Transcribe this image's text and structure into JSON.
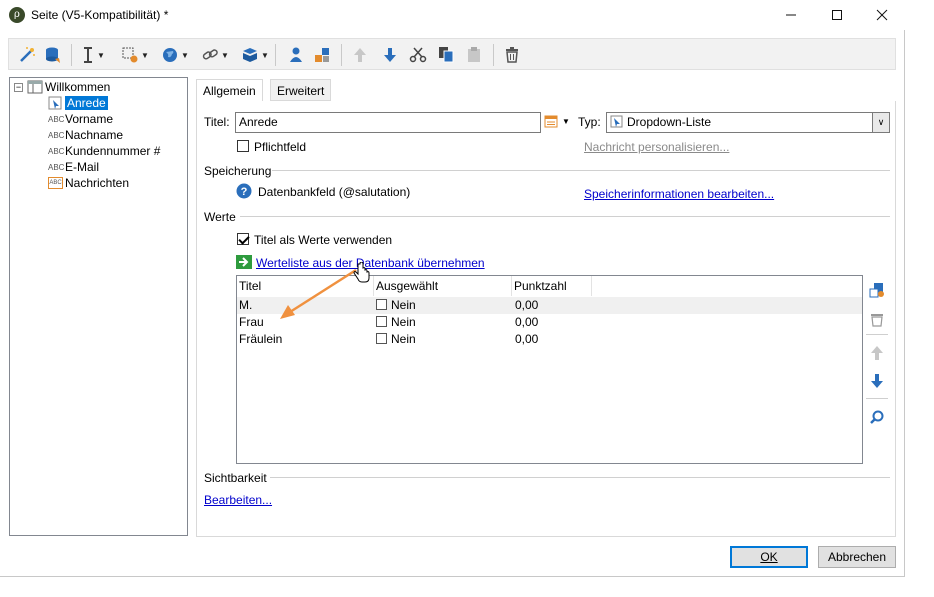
{
  "window": {
    "title": "Seite (V5-Kompatibilität) *"
  },
  "tree": {
    "root": "Willkommen",
    "items": [
      {
        "label": "Anrede",
        "selected": true
      },
      {
        "label": "Vorname",
        "type": "ABC"
      },
      {
        "label": "Nachname",
        "type": "ABC"
      },
      {
        "label": "Kundennummer #",
        "type": "ABC"
      },
      {
        "label": "E-Mail",
        "type": "ABC"
      },
      {
        "label": "Nachrichten",
        "type": "ABC"
      }
    ]
  },
  "tabs": [
    {
      "label": "Allgemein",
      "active": true
    },
    {
      "label": "Erweitert",
      "active": false
    }
  ],
  "general": {
    "title_label": "Titel:",
    "title_value": "Anrede",
    "type_label": "Typ:",
    "type_value": "Dropdown-Liste",
    "required_label": "Pflichtfeld",
    "personalize_link": "Nachricht personalisieren...",
    "storage_section": "Speicherung",
    "storage_value": "Datenbankfeld (@salutation)",
    "storage_link": "Speicherinformationen bearbeiten...",
    "values_section": "Werte",
    "use_titles_label": "Titel als Werte verwenden",
    "import_link": "Werteliste aus der Datenbank übernehmen",
    "visibility_section": "Sichtbarkeit",
    "edit_link": "Bearbeiten..."
  },
  "table": {
    "columns": [
      "Titel",
      "Ausgewählt",
      "Punktzahl"
    ],
    "rows": [
      {
        "title": "M.",
        "selected": "Nein",
        "score": "0,00"
      },
      {
        "title": "Frau",
        "selected": "Nein",
        "score": "0,00"
      },
      {
        "title": "Fräulein",
        "selected": "Nein",
        "score": "0,00"
      }
    ]
  },
  "buttons": {
    "ok": "OK",
    "cancel": "Abbrechen"
  },
  "colors": {
    "accent": "#0078d7",
    "annotation_arrow": "#f0913f",
    "link": "#0000cc"
  }
}
